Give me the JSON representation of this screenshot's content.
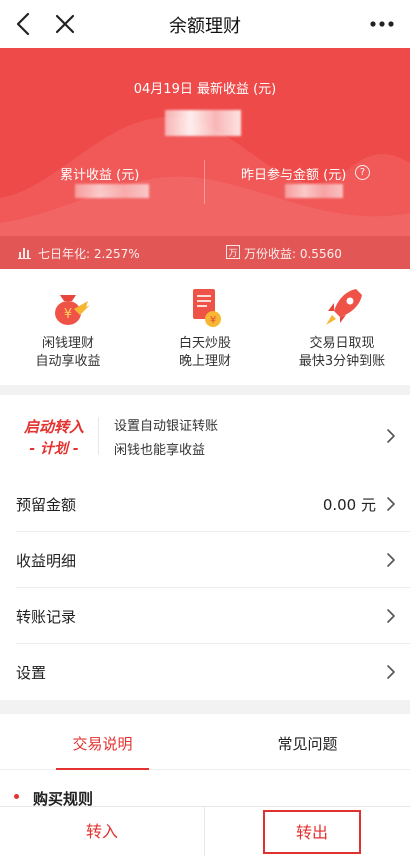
{
  "nav": {
    "title": "余额理财",
    "back_icon": "back-arrow-icon",
    "close_icon": "close-icon",
    "more_icon": "more-dots-icon"
  },
  "hero": {
    "date_label": "04月19日 最新收益 (元)",
    "cumulative_label": "累计收益 (元)",
    "yesterday_label": "昨日参与金额 (元)",
    "help_symbol": "?",
    "seven_day_label": "七日年化: 2.257%",
    "per_ten_k_label": "万份收益: 0.5560",
    "accent_color": "#ef4a4a"
  },
  "features": [
    {
      "lines": [
        "闲钱理财",
        "自动享收益"
      ],
      "icon": "money-bag-icon"
    },
    {
      "lines": [
        "白天炒股",
        "晚上理财"
      ],
      "icon": "document-coin-icon"
    },
    {
      "lines": [
        "交易日取现",
        "最快3分钟到账"
      ],
      "icon": "rocket-icon"
    }
  ],
  "promo": {
    "logo_line1": "启动转入",
    "logo_line2": "- 计划 -",
    "line1": "设置自动银证转账",
    "line2": "闲钱也能享收益"
  },
  "rows": [
    {
      "label": "预留金额",
      "value": "0.00 元"
    },
    {
      "label": "收益明细",
      "value": ""
    },
    {
      "label": "转账记录",
      "value": ""
    },
    {
      "label": "设置",
      "value": ""
    }
  ],
  "tabs": {
    "active": "交易说明",
    "inactive": "常见问题"
  },
  "rules": {
    "heading": "购买规则"
  },
  "bottom": {
    "transfer_in": "转入",
    "transfer_out": "转出",
    "brand_red": "#e3322f"
  }
}
